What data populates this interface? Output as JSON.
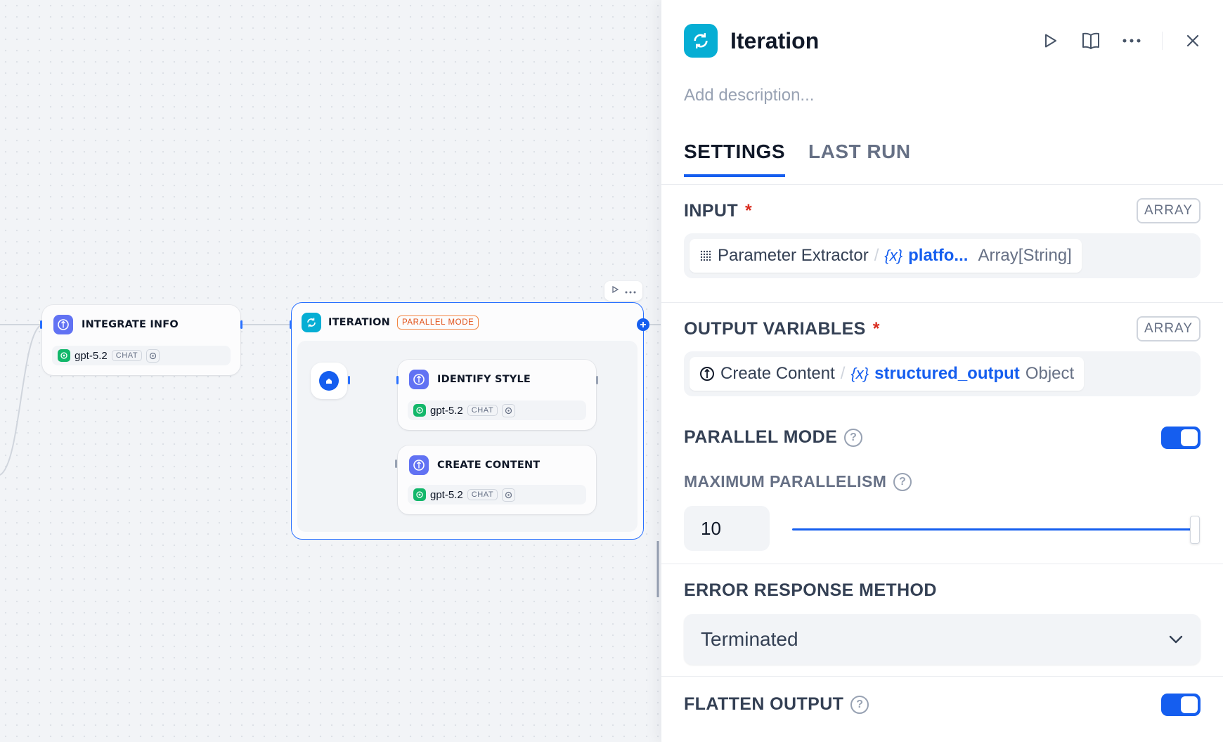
{
  "canvas": {
    "nodes": {
      "integrate_info": {
        "title": "INTEGRATE INFO",
        "model": "gpt-5.2",
        "mode": "CHAT"
      },
      "iteration": {
        "title": "ITERATION",
        "badge": "PARALLEL MODE"
      },
      "identify_style": {
        "title": "IDENTIFY STYLE",
        "model": "gpt-5.2",
        "mode": "CHAT"
      },
      "create_content": {
        "title": "CREATE CONTENT",
        "model": "gpt-5.2",
        "mode": "CHAT"
      }
    }
  },
  "panel": {
    "title": "Iteration",
    "description_placeholder": "Add description...",
    "tabs": [
      {
        "label": "SETTINGS",
        "active": true
      },
      {
        "label": "LAST RUN",
        "active": false
      }
    ],
    "input": {
      "label": "INPUT",
      "required_mark": "*",
      "type_badge": "ARRAY",
      "source_node": "Parameter Extractor",
      "separator": "/",
      "var_prefix": "{x}",
      "var_name": "platfo...",
      "var_type": "Array[String]"
    },
    "output": {
      "label": "OUTPUT VARIABLES",
      "required_mark": "*",
      "type_badge": "ARRAY",
      "source_node": "Create Content",
      "separator": "/",
      "var_prefix": "{x}",
      "var_name": "structured_output",
      "var_type": "Object"
    },
    "parallel_mode": {
      "label": "PARALLEL MODE",
      "help": "?",
      "enabled": true
    },
    "max_parallelism": {
      "label": "MAXIMUM PARALLELISM",
      "help": "?",
      "value": "10",
      "slider_fraction": 1.0
    },
    "error_response": {
      "label": "ERROR RESPONSE METHOD",
      "selected": "Terminated"
    },
    "flatten_output": {
      "label": "FLATTEN OUTPUT",
      "help": "?",
      "enabled": true
    }
  },
  "colors": {
    "accent": "#155eef",
    "iteration_icon": "#06aed4",
    "llm_icon": "#6172f3",
    "openai": "#12b76a",
    "badge_orange": "#e04f16"
  }
}
